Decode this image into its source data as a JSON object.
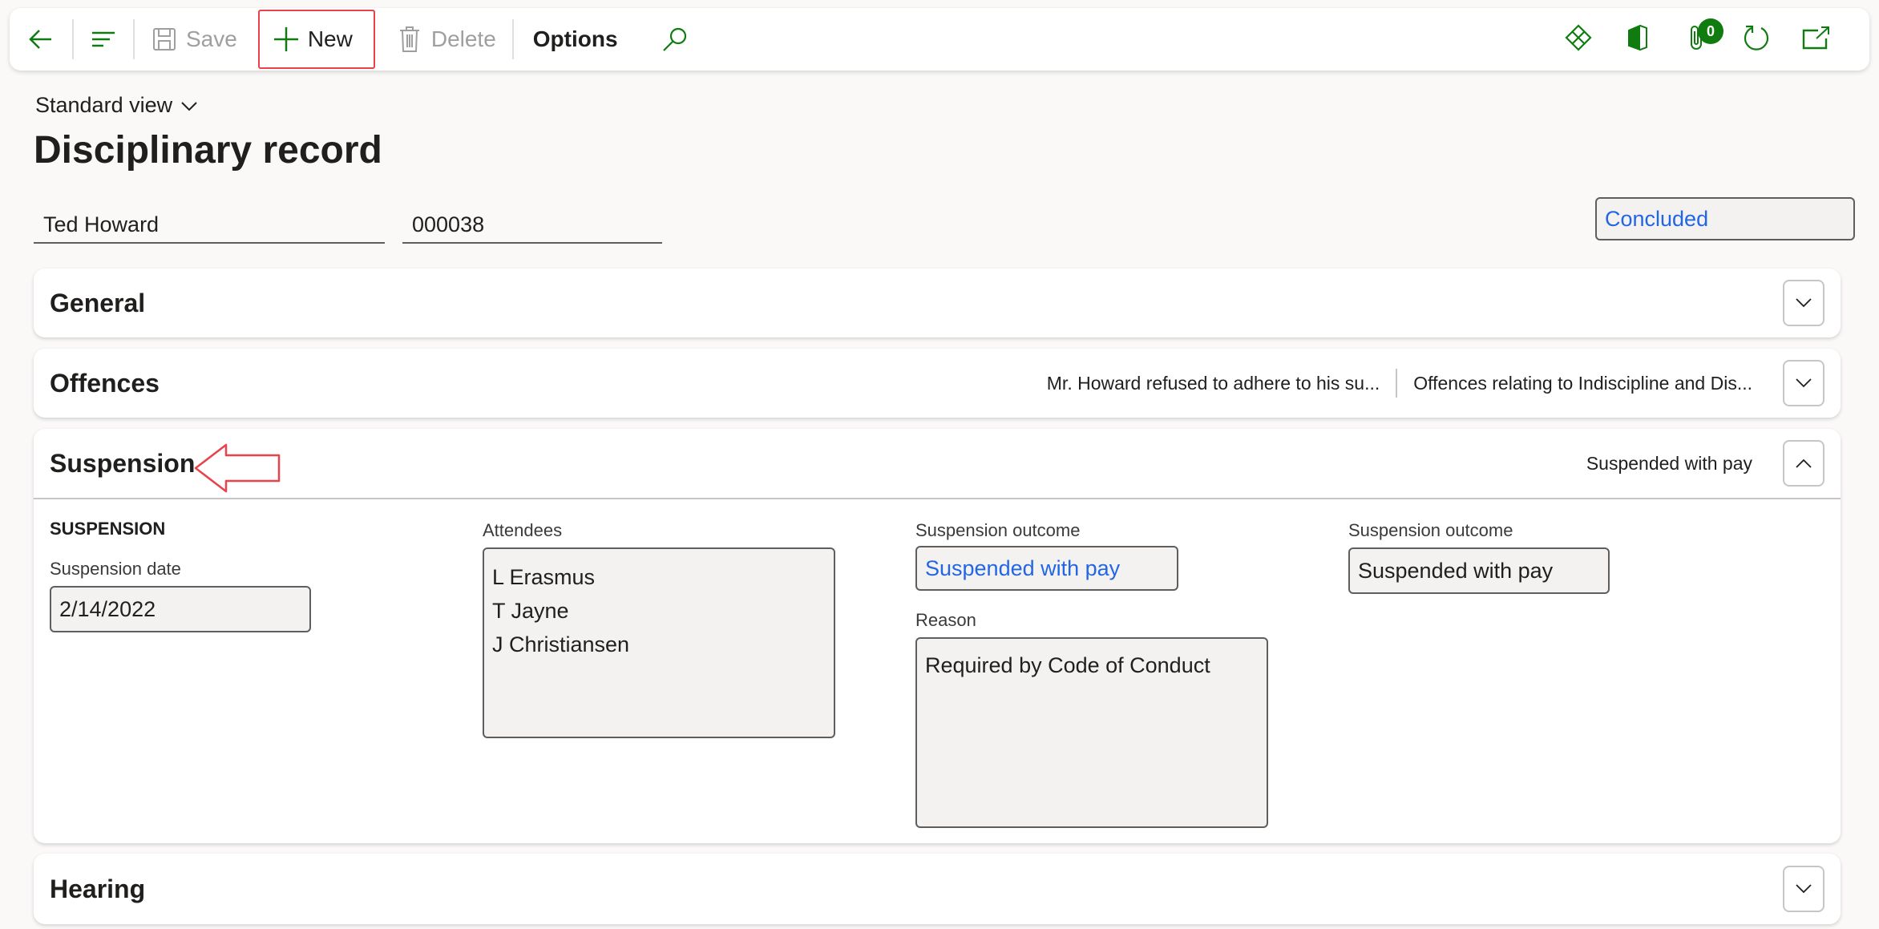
{
  "toolbar": {
    "back_label": "Back",
    "menu_label": "Menu",
    "save_label": "Save",
    "new_label": "New",
    "delete_label": "Delete",
    "options_label": "Options",
    "search_label": "Search",
    "attachments_count": "0",
    "right_icons": [
      "power-apps-icon",
      "office-icon",
      "attachment-icon",
      "refresh-icon",
      "open-new-window-icon"
    ]
  },
  "page": {
    "view_name": "Standard view",
    "title": "Disciplinary record"
  },
  "header_fields": {
    "employee": "Ted Howard",
    "record_id": "000038",
    "status": "Concluded"
  },
  "sections": {
    "general": {
      "title": "General"
    },
    "offences": {
      "title": "Offences",
      "summary_1": "Mr. Howard refused to adhere to his su...",
      "summary_2": "Offences relating to Indiscipline and Dis..."
    },
    "suspension": {
      "title": "Suspension",
      "summary": "Suspended with pay",
      "group_title": "SUSPENSION",
      "date_label": "Suspension date",
      "date_value": "2/14/2022",
      "attendees_label": "Attendees",
      "attendees": [
        "L Erasmus",
        "T Jayne",
        "J Christiansen"
      ],
      "outcome_label": "Suspension outcome",
      "outcome_value": "Suspended with pay",
      "reason_label": "Reason",
      "reason_value": "Required by Code of Conduct",
      "outcome2_label": "Suspension outcome",
      "outcome2_value": "Suspended with pay"
    },
    "hearing": {
      "title": "Hearing"
    }
  },
  "colors": {
    "accent_green": "#107c10",
    "link_blue": "#2266e3",
    "annotation_red": "#e8424c"
  }
}
